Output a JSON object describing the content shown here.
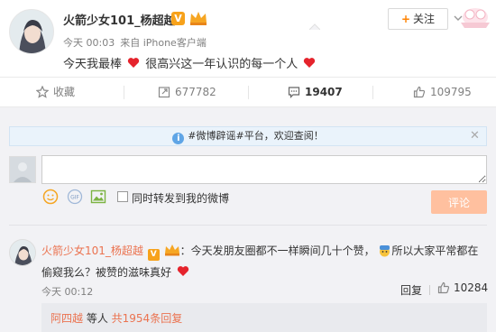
{
  "post": {
    "author": "火箭少女101_杨超越",
    "verified_badge": "V",
    "time": "今天 00:03",
    "source": "来自 iPhone客户端",
    "text_part1": "今天我最棒",
    "text_part2": "很高兴这一年认识的每一个人",
    "follow_label": "关注",
    "follow_plus": "+"
  },
  "actions": {
    "favorite": "收藏",
    "repost": "677782",
    "comment": "19407",
    "like": "109795"
  },
  "notice": {
    "text": "#微博辟谣#平台，欢迎查阅！",
    "close": "✕",
    "info": "i"
  },
  "composer": {
    "placeholder": "",
    "repost_label": "同时转发到我的微博",
    "submit_label": "评论"
  },
  "comment": {
    "author": "火箭少女101_杨超越",
    "badge": "V",
    "text_a": "：今天发朋友圈都不一样瞬间几十个赞，",
    "text_b": "所以大家平常都在偷窥我么？被赞的滋味真好",
    "time": "今天 00:12",
    "reply_label": "回复",
    "likes": "10284"
  },
  "sub_reply": {
    "name": "阿四越",
    "text": " 等人 ",
    "total": "共1954条回复"
  },
  "colors": {
    "accent": "#ff8200",
    "link": "#eb7350",
    "heart": "#e5232c",
    "vbadge": "#f7a21b",
    "panel_bg": "#f2f2f5",
    "submit_disabled": "#ffc09f"
  }
}
